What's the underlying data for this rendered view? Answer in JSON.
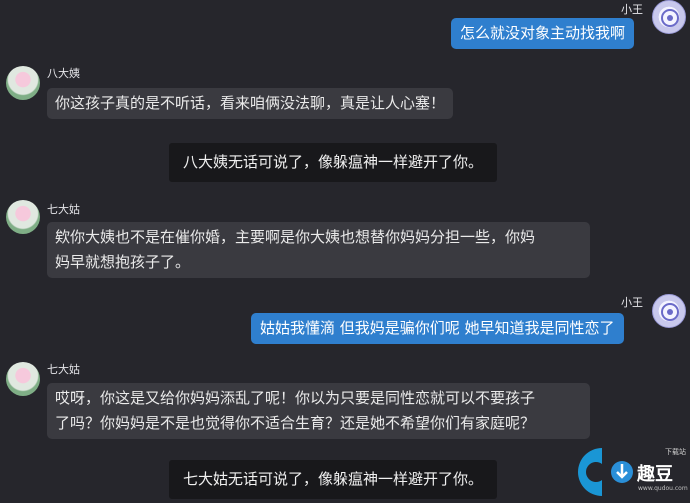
{
  "messages": [
    {
      "sender": "小王",
      "text": "怎么就没对象主动找我啊"
    },
    {
      "sender": "八大姨",
      "text": "你这孩子真的是不听话，看来咱俩没法聊，真是让人心塞！"
    },
    {
      "notice": "八大姨无话可说了，像躲瘟神一样避开了你。"
    },
    {
      "sender": "七大姑",
      "text_line1": "欸你大姨也不是在催你婚，主要啊是你大姨也想替你妈妈分担一些，你妈",
      "text_line2": "妈早就想抱孩子了。"
    },
    {
      "sender": "小王",
      "text": "姑姑我懂滴 但我妈是骗你们呢 她早知道我是同性恋了"
    },
    {
      "sender": "七大姑",
      "text_line1": "哎呀，你这是又给你妈妈添乱了呢！你以为只要是同性恋就可以不要孩子",
      "text_line2": "了吗？你妈妈是不是也觉得你不适合生育？还是她不希望你们有家庭呢？"
    },
    {
      "notice": "七大姑无话可说了，像躲瘟神一样避开了你。"
    }
  ],
  "watermark": {
    "brand": "趣豆",
    "sub": "下载站",
    "url": "www.qudou.com"
  },
  "colors": {
    "self_bubble": "#2f7fce",
    "other_bubble": "#3a3a40",
    "notice_bg": "#18181b",
    "background": "#26262c"
  }
}
